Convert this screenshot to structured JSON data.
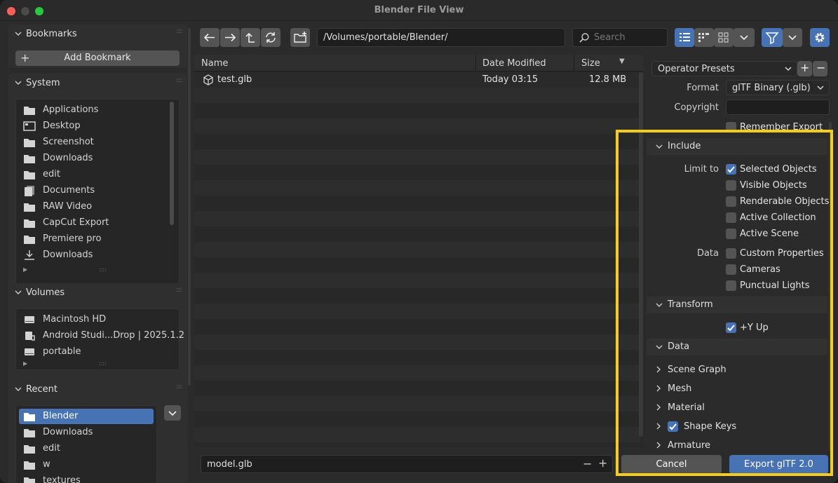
{
  "window": {
    "title": "Blender File View",
    "traffic_colors": [
      "#ff5f57",
      "#4a4a4a",
      "#28c840"
    ]
  },
  "sidebar": {
    "bookmarks": {
      "title": "Bookmarks",
      "add_label": "Add Bookmark"
    },
    "system": {
      "title": "System",
      "items": [
        {
          "label": "Applications",
          "icon": "folder-icon"
        },
        {
          "label": "Desktop",
          "icon": "desktop-icon"
        },
        {
          "label": "Screenshot",
          "icon": "folder-icon"
        },
        {
          "label": "Downloads",
          "icon": "folder-icon"
        },
        {
          "label": "edit",
          "icon": "folder-icon"
        },
        {
          "label": "Documents",
          "icon": "documents-icon"
        },
        {
          "label": "RAW Video",
          "icon": "folder-icon"
        },
        {
          "label": "CapCut Export",
          "icon": "folder-icon"
        },
        {
          "label": "Premiere pro",
          "icon": "folder-icon"
        },
        {
          "label": "Downloads",
          "icon": "download-icon"
        }
      ]
    },
    "volumes": {
      "title": "Volumes",
      "items": [
        {
          "label": "Macintosh HD",
          "icon": "disk-icon"
        },
        {
          "label": "Android Studi...Drop | 2025.1.2",
          "icon": "removable-disk-icon"
        },
        {
          "label": "portable",
          "icon": "disk-icon"
        }
      ]
    },
    "recent": {
      "title": "Recent",
      "items": [
        {
          "label": "Blender",
          "icon": "folder-icon",
          "selected": true
        },
        {
          "label": "Downloads",
          "icon": "folder-icon"
        },
        {
          "label": "edit",
          "icon": "folder-icon"
        },
        {
          "label": "w",
          "icon": "folder-icon"
        },
        {
          "label": "textures",
          "icon": "folder-icon"
        }
      ]
    }
  },
  "toolbar": {
    "path": "/Volumes/portable/Blender/",
    "search_placeholder": "Search"
  },
  "file_list": {
    "columns": [
      "Name",
      "Date Modified",
      "Size"
    ],
    "rows": [
      {
        "name": "test.glb",
        "date": "Today 03:15",
        "size": "12.8 MB"
      }
    ],
    "filename": "model.glb"
  },
  "settings": {
    "operator_presets": "Operator Presets",
    "format_label": "Format",
    "format_value": "glTF Binary (.glb)",
    "copyright_label": "Copyright",
    "copyright_value": "",
    "remember_export": "Remember Export",
    "include": {
      "title": "Include",
      "limit_to_label": "Limit to",
      "limit_to": [
        {
          "label": "Selected Objects",
          "checked": true
        },
        {
          "label": "Visible Objects",
          "checked": false
        },
        {
          "label": "Renderable Objects",
          "checked": false
        },
        {
          "label": "Active Collection",
          "checked": false
        },
        {
          "label": "Active Scene",
          "checked": false
        }
      ],
      "data_label": "Data",
      "data": [
        {
          "label": "Custom Properties",
          "checked": false
        },
        {
          "label": "Cameras",
          "checked": false
        },
        {
          "label": "Punctual Lights",
          "checked": false
        }
      ]
    },
    "transform": {
      "title": "Transform",
      "y_up": {
        "label": "+Y Up",
        "checked": true
      }
    },
    "data_section": {
      "title": "Data",
      "subsections": [
        {
          "label": "Scene Graph",
          "has_checkbox": false
        },
        {
          "label": "Mesh",
          "has_checkbox": false
        },
        {
          "label": "Material",
          "has_checkbox": false
        },
        {
          "label": "Shape Keys",
          "has_checkbox": true,
          "checked": true
        },
        {
          "label": "Armature",
          "has_checkbox": false
        }
      ]
    },
    "cancel_label": "Cancel",
    "export_label": "Export glTF 2.0"
  },
  "colors": {
    "accent": "#4772b3",
    "highlight": "#f2cd1d"
  }
}
